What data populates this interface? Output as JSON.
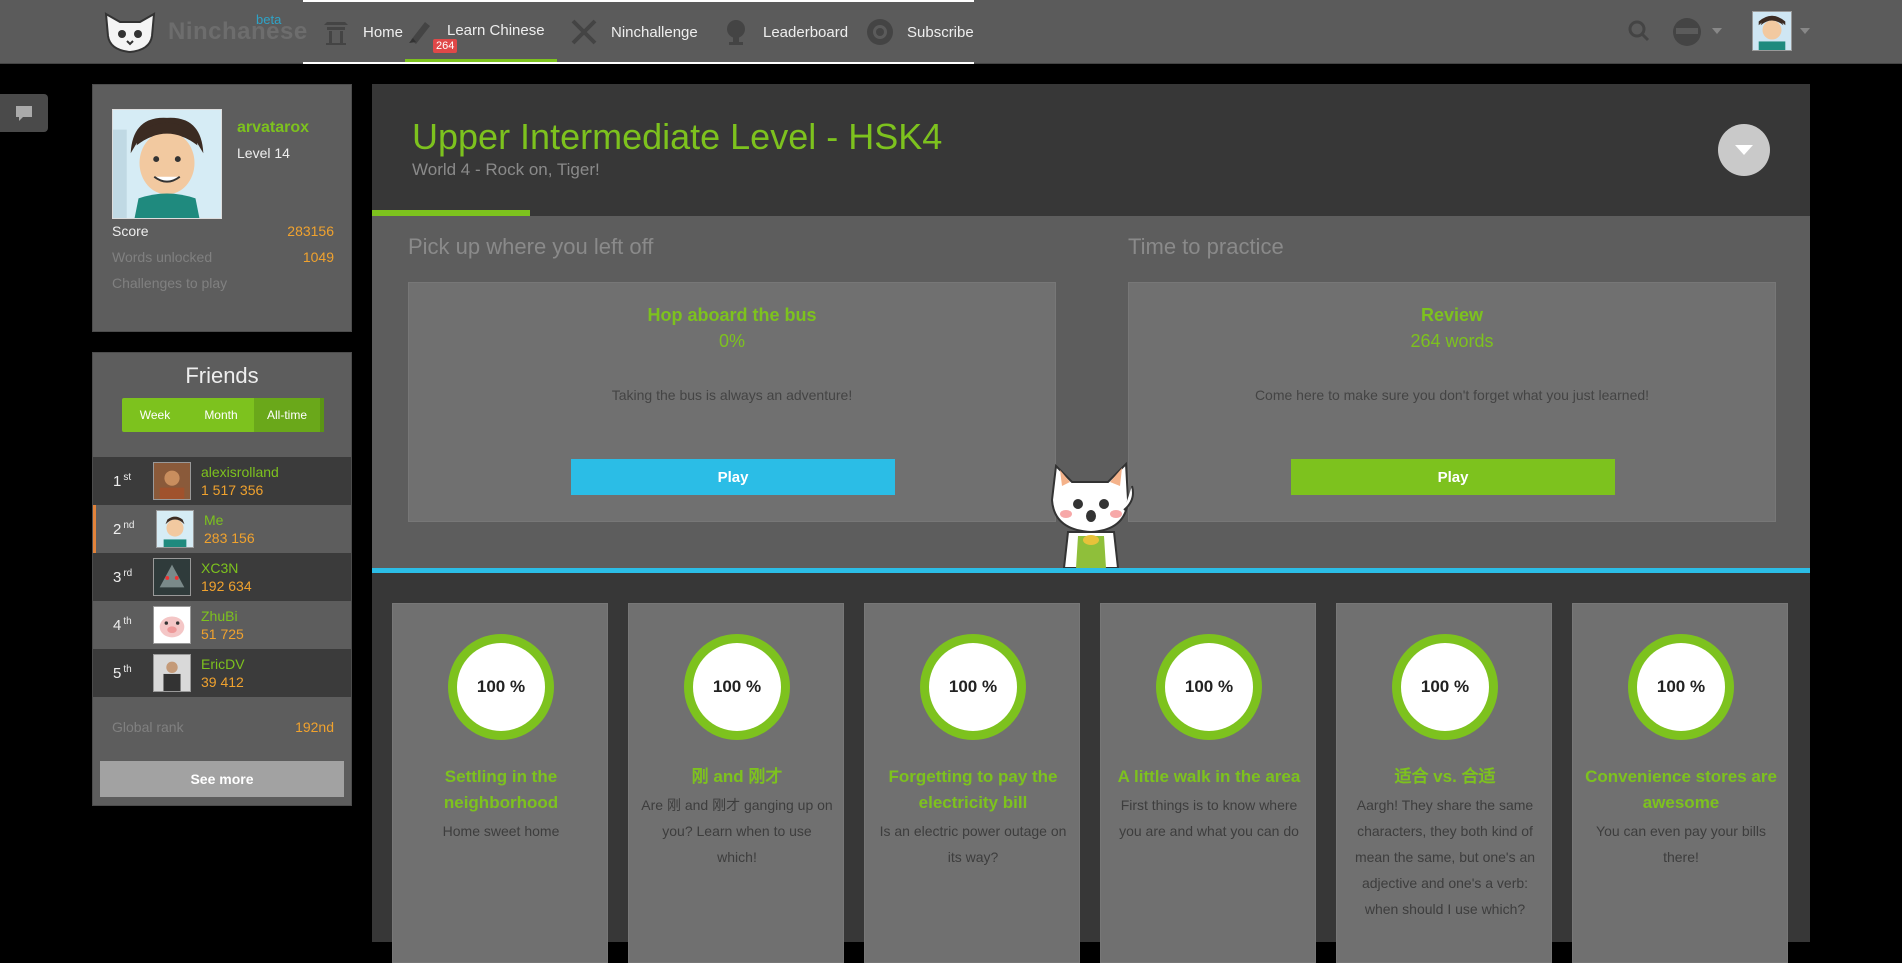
{
  "brand": {
    "name": "Ninchanese",
    "beta": "beta"
  },
  "nav": [
    {
      "label": "Home",
      "icon": "temple-icon"
    },
    {
      "label": "Learn Chinese",
      "icon": "brush-icon",
      "badge": "264"
    },
    {
      "label": "Ninchallenge",
      "icon": "swords-icon"
    },
    {
      "label": "Leaderboard",
      "icon": "trophy-icon"
    },
    {
      "label": "Subscribe",
      "icon": "coin-icon"
    }
  ],
  "profile": {
    "username": "arvatarox",
    "level": "Level 14",
    "stats": [
      {
        "label": "Score",
        "value": "283156"
      },
      {
        "label": "Words unlocked",
        "value": "1049"
      },
      {
        "label": "Challenges to play",
        "value": ""
      }
    ]
  },
  "friends": {
    "title": "Friends",
    "periods": [
      "Week",
      "Month",
      "All-time"
    ],
    "active_period": "All-time",
    "rows": [
      {
        "rank": "1",
        "suffix": "st",
        "name": "alexisrolland",
        "score": "1 517 356"
      },
      {
        "rank": "2",
        "suffix": "nd",
        "name": "Me",
        "score": "283 156"
      },
      {
        "rank": "3",
        "suffix": "rd",
        "name": "XC3N",
        "score": "192 634"
      },
      {
        "rank": "4",
        "suffix": "th",
        "name": "ZhuBi",
        "score": "51 725"
      },
      {
        "rank": "5",
        "suffix": "th",
        "name": "EricDV",
        "score": "39 412"
      }
    ],
    "global_rank_label": "Global rank",
    "global_rank_value": "192nd",
    "see_more": "See more"
  },
  "level": {
    "title": "Upper Intermediate Level - HSK4",
    "subtitle": "World 4 - Rock on, Tiger!",
    "progress_fraction": 0.11
  },
  "practice": {
    "left": {
      "heading": "Pick up where you left off",
      "title": "Hop aboard the bus",
      "sub": "0%",
      "desc": "Taking the bus is always an adventure!",
      "button": "Play"
    },
    "right": {
      "heading": "Time to practice",
      "title": "Review",
      "sub": "264 words",
      "desc": "Come here to make sure you don't forget what you just learned!",
      "button": "Play"
    }
  },
  "lessons": [
    {
      "progress": "100 %",
      "title": "Settling in the neighborhood",
      "desc": "Home sweet home"
    },
    {
      "progress": "100 %",
      "title": "刚 and 刚才",
      "desc": "Are 刚 and 刚才 ganging up on you? Learn when to use which!"
    },
    {
      "progress": "100 %",
      "title": "Forgetting to pay the electricity bill",
      "desc": "Is an electric power outage on its way?"
    },
    {
      "progress": "100 %",
      "title": "A little walk in the area",
      "desc": "First things is to know where you are and what you can do"
    },
    {
      "progress": "100 %",
      "title": "适合 vs. 合适",
      "desc": "Aargh! They share the same characters, they both kind of mean the same, but one's an adjective and one's a verb: when should I use which?"
    },
    {
      "progress": "100 %",
      "title": "Convenience stores are awesome",
      "desc": "You can even pay your bills there!"
    }
  ],
  "colors": {
    "accent": "#7dc21e",
    "score": "#f0a22e",
    "blue": "#2bbde6"
  }
}
